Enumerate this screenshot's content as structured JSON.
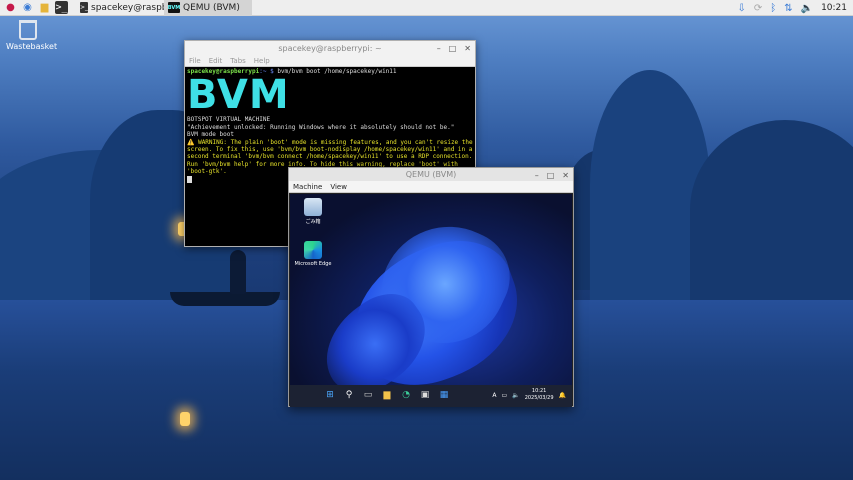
{
  "panel": {
    "terminal_task_label": "spacekey@raspberry...",
    "qemu_task_label": "QEMU (BVM)",
    "clock": "10:21"
  },
  "desktop": {
    "wastebasket_label": "Wastebasket"
  },
  "terminal": {
    "title": "spacekey@raspberrypi: ~",
    "menu": [
      "File",
      "Edit",
      "Tabs",
      "Help"
    ],
    "prompt_user": "spacekey@raspberrypi",
    "prompt_path": ":~ $",
    "command": " bvm/bvm boot /home/spacekey/win11",
    "logo": "BVM",
    "logo_caption": "BOTSPOT VIRTUAL MACHINE",
    "achievement": "\"Achievement unlocked: Running Windows where it absolutely should not be.\"",
    "mode": "BVM mode boot",
    "warning": "⚠️ WARNING: The plain 'boot' mode is missing features, and you can't resize the screen. To fix this, use 'bvm/bvm boot-nodisplay /home/spacekey/win11' and in a second terminal 'bvm/bvm connect /home/spacekey/win11' to use a RDP connection. Run 'bvm/bvm help' for more info. To hide this warning, replace 'boot' with 'boot-gtk'."
  },
  "qemu": {
    "title": "QEMU (BVM)",
    "menu": [
      "Machine",
      "View"
    ],
    "guest": {
      "recycle_label": "ごみ箱",
      "edge_label": "Microsoft Edge",
      "taskbar_time": "10:21",
      "taskbar_date": "2025/03/29",
      "lang_indicator": "A"
    }
  },
  "icons": {
    "panel": [
      "raspberry-icon",
      "globe-icon",
      "folder-icon",
      "terminal-icon"
    ],
    "tray": [
      "update-icon",
      "sync-icon",
      "bluetooth-icon",
      "network-icon",
      "volume-icon"
    ]
  }
}
